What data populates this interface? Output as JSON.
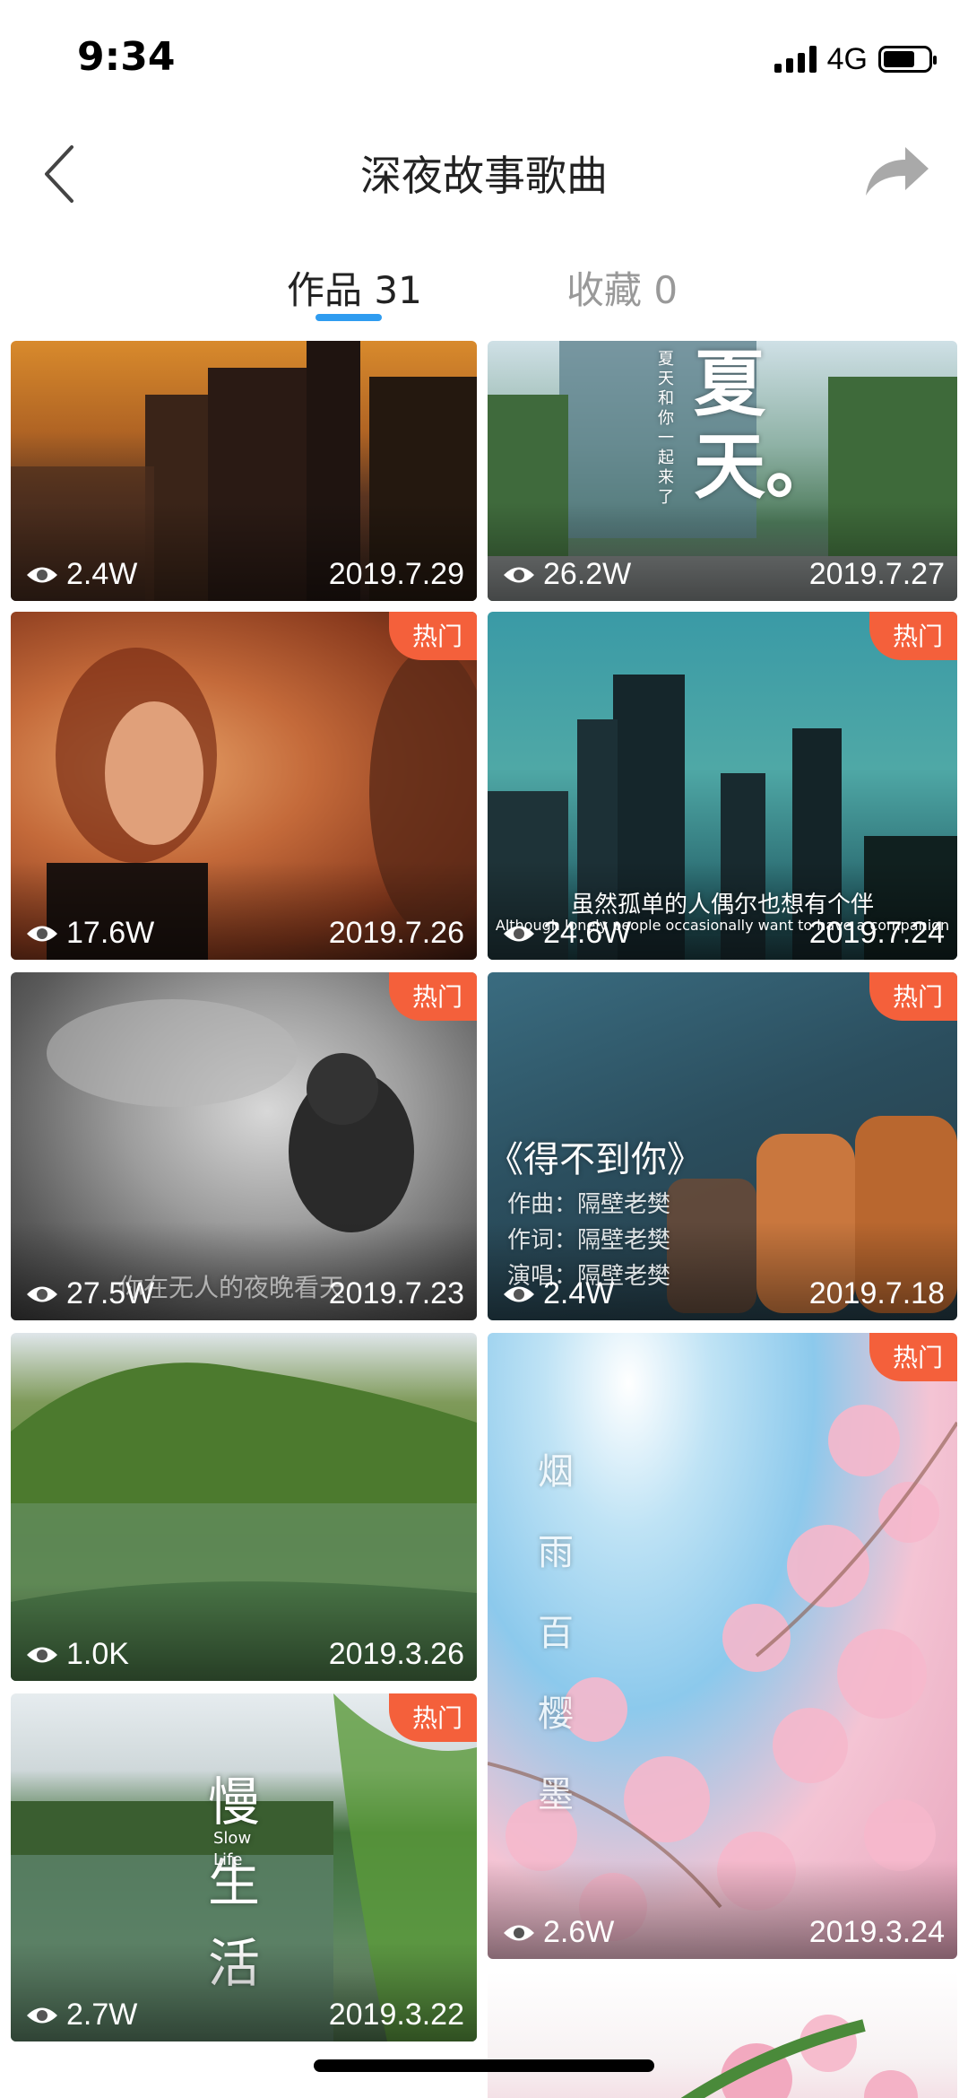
{
  "status_bar": {
    "time": "9:34",
    "network": "4G",
    "battery_level": 0.7
  },
  "nav": {
    "title": "深夜故事歌曲",
    "back_icon": "chevron-left-icon",
    "share_icon": "share-arrow-icon"
  },
  "tabs": [
    {
      "label": "作品 31",
      "active": true
    },
    {
      "label": "收藏 0",
      "active": false
    }
  ],
  "hot_label": "热门",
  "cards": [
    {
      "views": "2.4W",
      "date": "2019.7.29",
      "hot": false
    },
    {
      "views": "26.2W",
      "date": "2019.7.27",
      "hot": false,
      "overlay": "夏天。",
      "overlay_small": "夏天和你 一起来了"
    },
    {
      "views": "17.6W",
      "date": "2019.7.26",
      "hot": true
    },
    {
      "views": "24.6W",
      "date": "2019.7.24",
      "hot": true,
      "overlay": "虽然孤单的人偶尔也想有个伴",
      "overlay_small": "Although lonely people occasionally want to have a companion"
    },
    {
      "views": "27.5W",
      "date": "2019.7.23",
      "hot": true,
      "overlay": "你在无人的夜晚看天"
    },
    {
      "views": "2.4W",
      "date": "2019.7.18",
      "hot": true,
      "overlay": "《得不到你》",
      "overlay_lines": [
        "作曲：隔壁老樊",
        "作词：隔壁老樊",
        "演唱：隔壁老樊"
      ]
    },
    {
      "views": "1.0K",
      "date": "2019.3.26",
      "hot": false
    },
    {
      "views": "2.6W",
      "date": "2019.3.24",
      "hot": true,
      "overlay": "烟雨百樱墨"
    },
    {
      "views": "2.7W",
      "date": "2019.3.22",
      "hot": true,
      "overlay": "慢生活",
      "overlay_small": "Slow Life"
    }
  ]
}
